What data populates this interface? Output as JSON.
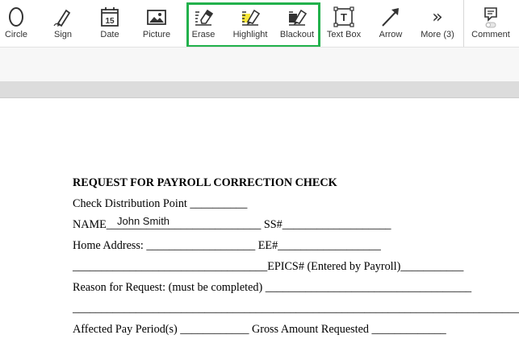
{
  "toolbar": {
    "tools": [
      {
        "id": "circle",
        "label": "Circle",
        "icon": "circle-icon"
      },
      {
        "id": "sign",
        "label": "Sign",
        "icon": "pen-icon"
      },
      {
        "id": "date",
        "label": "Date",
        "icon": "calendar-icon",
        "icon_text": "15"
      },
      {
        "id": "picture",
        "label": "Picture",
        "icon": "picture-icon"
      },
      {
        "id": "erase",
        "label": "Erase",
        "icon": "eraser-icon"
      },
      {
        "id": "highlight",
        "label": "Highlight",
        "icon": "highlighter-icon"
      },
      {
        "id": "blackout",
        "label": "Blackout",
        "icon": "blackout-icon"
      },
      {
        "id": "textbox",
        "label": "Text Box",
        "icon": "textbox-icon",
        "icon_text": "T"
      },
      {
        "id": "arrow",
        "label": "Arrow",
        "icon": "arrow-icon"
      },
      {
        "id": "more",
        "label": "More (3)",
        "icon": "double-chevron-icon",
        "icon_text": "»"
      },
      {
        "id": "comment",
        "label": "Comment",
        "icon": "comment-icon"
      }
    ],
    "highlight_color": "#22b14c",
    "highlighter_yellow": "#f5e63a"
  },
  "document": {
    "title": "REQUEST FOR PAYROLL CORRECTION CHECK",
    "lines": [
      "Check Distribution Point __________",
      "NAME___________________________ SS#___________________",
      "Home Address: ___________________ EE#__________________",
      "__________________________________EPICS# (Entered by Payroll)___________",
      "Reason for Request: (must be completed) ____________________________________",
      "_______________________________________________________________________________",
      "Affected Pay Period(s) ____________ Gross Amount Requested _____________"
    ],
    "filled_name": "John Smith"
  }
}
